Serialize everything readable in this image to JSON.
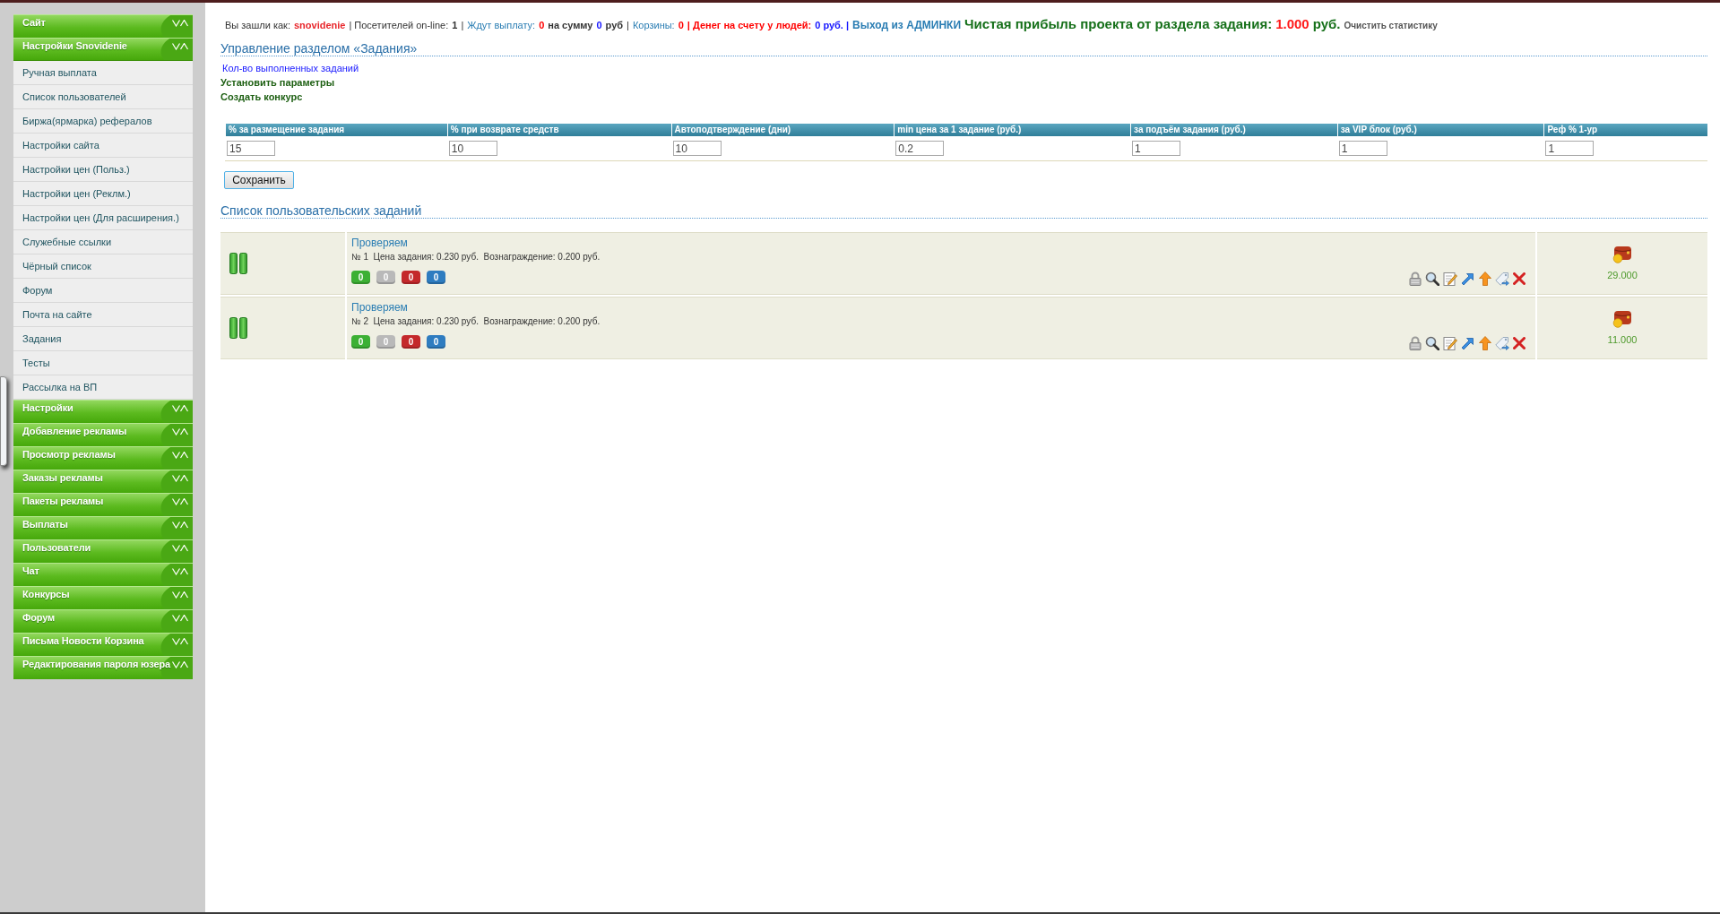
{
  "status_bar": {
    "segments": [
      {
        "kind": "label",
        "text": "Вы зашли как:"
      },
      {
        "kind": "user",
        "text": "snovidenie"
      },
      {
        "kind": "label",
        "text": "| Посетителей on-line:"
      },
      {
        "kind": "number",
        "text": "1"
      },
      {
        "kind": "label",
        "text": "|"
      },
      {
        "kind": "link",
        "text": "Ждут выплату:"
      },
      {
        "kind": "count",
        "text": "0"
      },
      {
        "kind": "number",
        "text": "на сумму"
      },
      {
        "kind": "sum",
        "text": "0"
      },
      {
        "kind": "number",
        "text": "руб"
      },
      {
        "kind": "label",
        "text": "|"
      },
      {
        "kind": "link",
        "text": "Корзины:"
      },
      {
        "kind": "count",
        "text": "0"
      },
      {
        "kind": "alert",
        "text": "| Денег на счету у людей:"
      },
      {
        "kind": "sum",
        "text": "0 руб. |"
      },
      {
        "kind": "exit",
        "text": "Выход из АДМИНКИ"
      },
      {
        "kind": "profit",
        "text": "Чистая прибыль проекта от раздела задания:"
      },
      {
        "kind": "profit_value",
        "text": "1.000"
      },
      {
        "kind": "profit",
        "text": "руб."
      },
      {
        "kind": "clear",
        "text": "Очистить статистику"
      }
    ]
  },
  "sidebar": {
    "groups": [
      {
        "title": "Сайт",
        "expanded": false
      },
      {
        "title": "Настройки Snovidenie",
        "expanded": true,
        "items": [
          "Ручная выплата",
          "Список пользователей",
          "Биржа(ярмарка) рефералов",
          "Настройки сайта",
          "Настройки цен (Польз.)",
          "Настройки цен (Реклм.)",
          "Настройки цен (Для расширения.)",
          "Служебные ссылки",
          "Чёрный список",
          "Форум",
          "Почта на сайте",
          "Задания",
          "Тесты",
          "Рассылка на ВП"
        ]
      },
      {
        "title": "Настройки",
        "expanded": false
      },
      {
        "title": "Добавление рекламы",
        "expanded": false
      },
      {
        "title": "Просмотр рекламы",
        "expanded": false
      },
      {
        "title": "Заказы рекламы",
        "expanded": false
      },
      {
        "title": "Пакеты рекламы",
        "expanded": false
      },
      {
        "title": "Выплаты",
        "expanded": false
      },
      {
        "title": "Пользователи",
        "expanded": false
      },
      {
        "title": "Чат",
        "expanded": false
      },
      {
        "title": "Конкурсы",
        "expanded": false
      },
      {
        "title": "Форум",
        "expanded": false
      },
      {
        "title": "Письма Новости Корзина",
        "expanded": false
      },
      {
        "title": "Редактирования пароля юзера",
        "expanded": false
      }
    ]
  },
  "task_section": {
    "title": "Управление разделом «Задания»",
    "links": [
      {
        "kind": "link",
        "text": "Кол-во выполненных заданий"
      },
      {
        "kind": "action",
        "text": "Установить параметры"
      },
      {
        "kind": "action",
        "text": "Создать конкурс"
      }
    ]
  },
  "settings_table": {
    "columns": [
      "% за размещение задания",
      "% при возврате средств",
      "Автоподтверждение (дни)",
      "min цена за 1 задание (руб.)",
      "за подъём задания (руб.)",
      "за VIP блок (руб.)",
      "Реф % 1-ур"
    ],
    "values": [
      "15",
      "10",
      "10",
      "0.2",
      "1",
      "1",
      "1"
    ],
    "save_button": "Сохранить"
  },
  "task_list": {
    "title": "Список пользовательских заданий",
    "tasks": [
      {
        "title": "Проверяем",
        "details": "№ 1  Цена задания: 0.230 руб.  Вознаграждение: 0.200 руб.",
        "counters": [
          {
            "text": "0",
            "color": "#3cb034"
          },
          {
            "text": "0",
            "color": "#b9b9b9"
          },
          {
            "text": "0",
            "color": "#c4282b"
          },
          {
            "text": "0",
            "color": "#2e7cc0"
          }
        ],
        "balance": "29.000"
      },
      {
        "title": "Проверяем",
        "details": "№ 2  Цена задания: 0.230 руб.  Вознаграждение: 0.200 руб.",
        "counters": [
          {
            "text": "0",
            "color": "#3cb034"
          },
          {
            "text": "0",
            "color": "#b9b9b9"
          },
          {
            "text": "0",
            "color": "#c4282b"
          },
          {
            "text": "0",
            "color": "#2e7cc0"
          }
        ],
        "balance": "11.000"
      }
    ]
  }
}
